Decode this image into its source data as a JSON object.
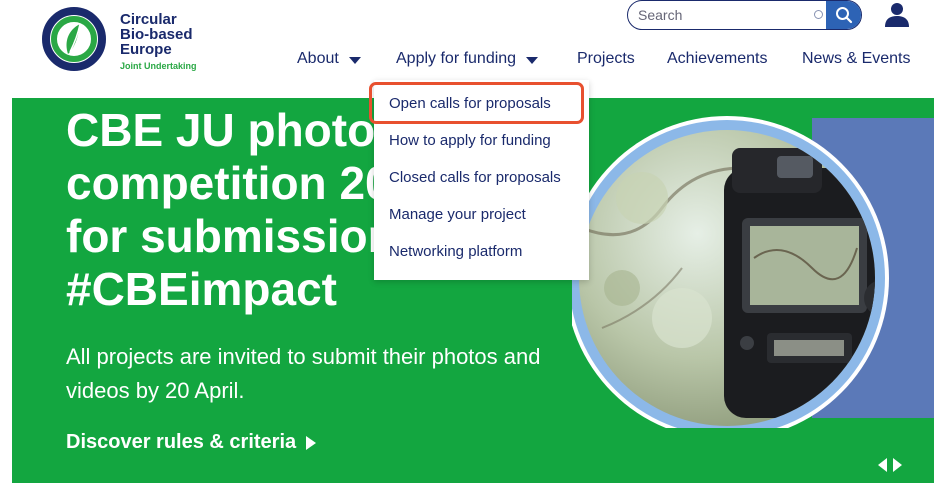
{
  "header": {
    "logo": {
      "line1": "Circular",
      "line2": "Bio-based",
      "line3": "Europe",
      "line4": "Joint Undertaking",
      "icon": "cbe-ring-logo"
    },
    "search": {
      "placeholder": "Search",
      "icon": "search-icon"
    },
    "user_icon": "user-icon"
  },
  "nav": {
    "about": "About",
    "apply": "Apply for funding",
    "projects": "Projects",
    "achievements": "Achievements",
    "news": "News & Events"
  },
  "dropdown": {
    "items": [
      "Open calls for proposals",
      "How to apply for funding",
      "Closed calls for proposals",
      "Manage your project",
      "Networking platform"
    ]
  },
  "hero": {
    "title": [
      "CBE JU photo",
      "competition 20",
      "for submission",
      "#CBEimpact"
    ],
    "description": "All projects are invited to submit their photos and videos by 20 April.",
    "cta": "Discover rules & criteria"
  },
  "colors": {
    "navy": "#1a2a6c",
    "green": "#13a640",
    "accent_blue": "#2d63b5",
    "highlight": "#e8502f",
    "ring": "#8cb8e8",
    "panel_blue": "#5b79b8"
  }
}
